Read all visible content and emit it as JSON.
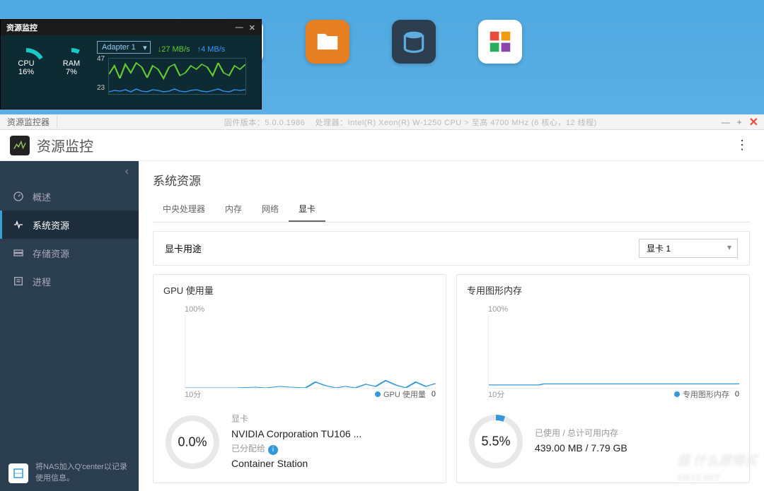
{
  "widget": {
    "title": "资源监控",
    "cpu_label": "CPU",
    "cpu_pct": "16%",
    "ram_label": "RAM",
    "ram_pct": "7%",
    "adapter": "Adapter 1",
    "down_speed": "27 MB/s",
    "up_speed": "4 MB/s",
    "graph_max": "47",
    "graph_mid": "23"
  },
  "breadcrumb": {
    "label": "资源监控器",
    "firmware": "固件版本：5.0.0.1986",
    "processor": "处理器：Intel(R) Xeon(R) W-1250 CPU > 至高 4700 MHz (6 核心，12 线程)"
  },
  "app": {
    "title": "资源监控"
  },
  "sidebar": {
    "items": [
      {
        "label": "概述"
      },
      {
        "label": "系统资源"
      },
      {
        "label": "存储资源"
      },
      {
        "label": "进程"
      }
    ],
    "footer": "将NAS加入Q'center以记录使用信息。"
  },
  "content": {
    "title": "系统资源",
    "tabs": [
      "中央处理器",
      "内存",
      "网络",
      "显卡"
    ],
    "gpu_use_panel": "显卡用途",
    "gpu_select": "显卡 1"
  },
  "gpu_card": {
    "title": "GPU 使用量",
    "ylabel": "100%",
    "xlabel": "10分",
    "legend": "GPU 使用量",
    "legend_val": "0",
    "pct": "0.0%",
    "info_label": "显卡",
    "info_main": "NVIDIA Corporation TU106 ...",
    "assigned_label": "已分配给",
    "assigned_to": "Container Station"
  },
  "mem_card": {
    "title": "专用图形内存",
    "ylabel": "100%",
    "xlabel": "10分",
    "legend": "专用图形内存",
    "legend_val": "0",
    "pct": "5.5%",
    "used_label": "已使用 / 总计可用内存",
    "used_val": "439.00 MB",
    "total_val": "7.79 GB"
  },
  "watermark": "值 什么原得买\nSMYZ.NET",
  "chart_data": [
    {
      "type": "line",
      "title": "GPU 使用量",
      "xlabel": "10分",
      "ylabel": "%",
      "ylim": [
        0,
        100
      ],
      "series": [
        {
          "name": "GPU 使用量",
          "values": [
            0,
            0,
            0,
            0,
            0,
            0,
            1,
            0,
            0,
            0,
            2,
            1,
            0,
            8,
            3,
            0,
            2,
            0,
            5,
            2,
            10,
            4,
            0,
            8,
            2,
            6,
            1,
            0
          ]
        }
      ]
    },
    {
      "type": "line",
      "title": "专用图形内存",
      "xlabel": "10分",
      "ylabel": "%",
      "ylim": [
        0,
        100
      ],
      "series": [
        {
          "name": "专用图形内存",
          "values": [
            4,
            4,
            4,
            4,
            4,
            4,
            5.5,
            5.5,
            5.5,
            5.5,
            5.5,
            5.5,
            5.5,
            5.5,
            5.5,
            5.5,
            5.5,
            5.5,
            5.5,
            5.5,
            5.5,
            5.5,
            5.5,
            5.5,
            5.5,
            5.5,
            5.5,
            5.5
          ]
        }
      ]
    },
    {
      "type": "line",
      "title": "Network",
      "ylim": [
        0,
        47
      ],
      "series": [
        {
          "name": "down",
          "values": [
            25,
            40,
            20,
            42,
            30,
            44,
            38,
            22,
            40,
            35,
            20,
            38,
            42,
            25,
            30,
            40,
            35,
            42,
            38,
            26,
            44,
            30,
            25,
            40
          ]
        },
        {
          "name": "up",
          "values": [
            2,
            4,
            3,
            5,
            2,
            6,
            3,
            2,
            5,
            4,
            2,
            3,
            6,
            3,
            2,
            4,
            5,
            3,
            2,
            4,
            6,
            3,
            2,
            5
          ]
        }
      ]
    }
  ]
}
